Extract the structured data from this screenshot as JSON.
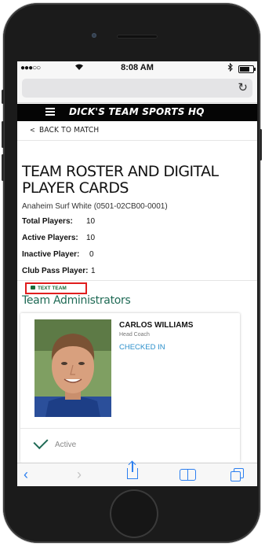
{
  "status_bar": {
    "carrier": "●●●○○",
    "time": "8:08 AM"
  },
  "site": {
    "title": "DICK'S TEAM SPORTS HQ"
  },
  "nav": {
    "back_label": "BACK TO MATCH"
  },
  "page": {
    "title": "TEAM ROSTER AND DIGITAL PLAYER CARDS",
    "team": "Anaheim Surf White (0501-02CB00-0001)"
  },
  "stats": [
    {
      "label": "Total Players:",
      "value": "10"
    },
    {
      "label": "Active Players:",
      "value": "10"
    },
    {
      "label": "Inactive Player:",
      "value": "0"
    },
    {
      "label": "Club Pass Player:",
      "value": "1"
    }
  ],
  "text_team": {
    "label": "TEXT TEAM"
  },
  "section": {
    "title": "Team Administrators"
  },
  "admin_card": {
    "name": "CARLOS WILLIAMS",
    "role": "Head Coach",
    "status": "CHECKED IN",
    "active_label": "Active"
  },
  "colors": {
    "accent_green": "#1f6a55",
    "link_blue": "#2b8fcb",
    "highlight_red": "#e01e1e",
    "header_black": "#050505",
    "safari_blue": "#2c7ff0"
  },
  "icons": {
    "wifi": "wifi-icon",
    "bluetooth": "bluetooth-icon",
    "battery": "battery-icon",
    "reload": "reload-icon",
    "menu": "hamburger-icon",
    "back_chevron": "chevron-left-icon",
    "chat": "chat-icon",
    "check": "check-icon",
    "safari_back": "chevron-left-icon",
    "safari_forward": "chevron-right-icon",
    "share": "share-icon",
    "bookmarks": "book-icon",
    "tabs": "tabs-icon"
  }
}
